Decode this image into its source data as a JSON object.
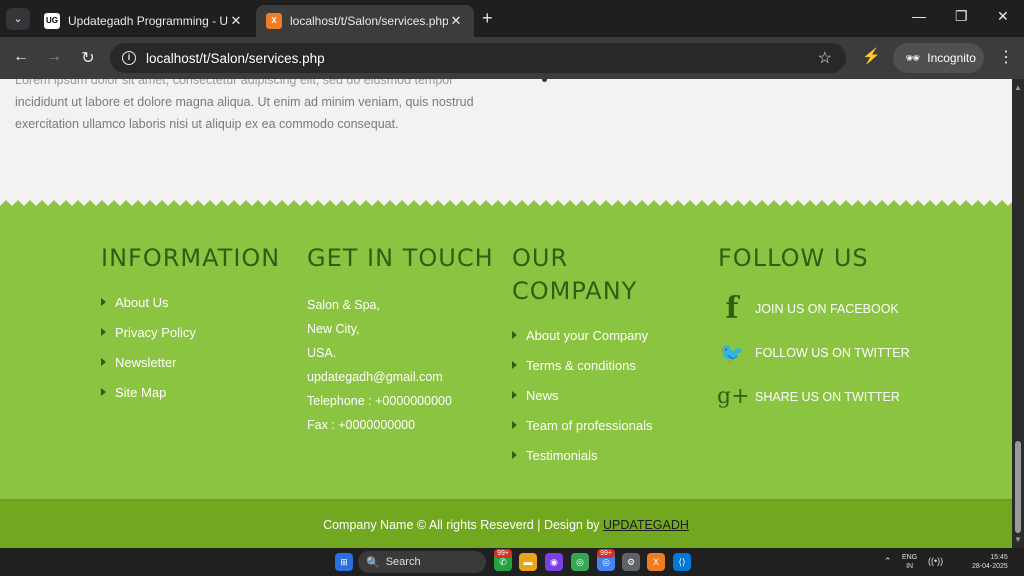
{
  "browser": {
    "tabs": [
      {
        "title": "Updategadh Programming - Upda",
        "favicon": "UG",
        "active": false
      },
      {
        "title": "localhost/t/Salon/services.php",
        "favicon": "X",
        "active": true
      }
    ],
    "url": "localhost/t/Salon/services.php",
    "incognito_label": "Incognito"
  },
  "page": {
    "intro_text_cut": "Lorem ipsum dolor sit amet, consectetur adipiscing elit, sed do eiusmod tempor",
    "intro_text_line1": "incididunt ut labore et dolore magna aliqua. Ut enim ad minim veniam, quis nostrud",
    "intro_text_line2": "exercitation ullamco laboris nisi ut aliquip ex ea commodo consequat."
  },
  "footer": {
    "information": {
      "title": "INFORMATION",
      "links": [
        "About Us",
        "Privacy Policy",
        "Newsletter",
        "Site Map"
      ]
    },
    "contact": {
      "title": "GET IN TOUCH",
      "lines": [
        "Salon & Spa,",
        "New City,",
        "USA.",
        "updategadh@gmail.com",
        "Telephone : +0000000000",
        "Fax : +0000000000"
      ]
    },
    "company": {
      "title_line1": "OUR",
      "title_line2": "COMPANY",
      "links": [
        "About your Company",
        "Terms & conditions",
        "News",
        "Team of professionals",
        "Testimonials"
      ]
    },
    "follow": {
      "title": "FOLLOW US",
      "items": [
        {
          "label": "JOIN US ON FACEBOOK",
          "icon": "facebook-icon",
          "glyph": "f"
        },
        {
          "label": "FOLLOW US ON TWITTER",
          "icon": "twitter-icon",
          "glyph": "🐦"
        },
        {
          "label": "SHARE US ON TWITTER",
          "icon": "google-plus-icon",
          "glyph": "g+"
        }
      ]
    },
    "copyright": "Company Name © All rights Reseverd | Design by ",
    "designer_link": "UPDATEGADH"
  },
  "colors": {
    "footer_green": "#8bc441",
    "title_green": "#2f5f12",
    "bottom_bar": "#72a81f"
  },
  "taskbar": {
    "search_label": "Search",
    "lang_line1": "ENG",
    "lang_line2": "IN",
    "time": "15:45",
    "date": "28-04-2025",
    "badge_1": "99+",
    "badge_2": "99+"
  }
}
